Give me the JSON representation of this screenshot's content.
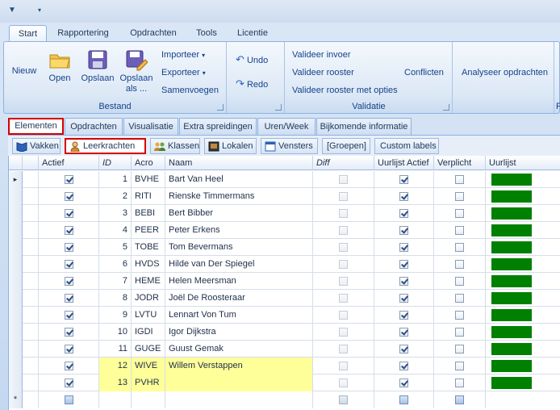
{
  "ribbon_tabs": [
    {
      "label": "Start"
    },
    {
      "label": "Rapportering"
    },
    {
      "label": "Opdrachten"
    },
    {
      "label": "Tools"
    },
    {
      "label": "Licentie"
    }
  ],
  "groups": {
    "bestand": {
      "label": "Bestand",
      "nieuw": "Nieuw",
      "open": "Open",
      "opslaan": "Opslaan",
      "opslaan_als_1": "Opslaan",
      "opslaan_als_2": "als ...",
      "importeer": "Importeer",
      "exporteer": "Exporteer",
      "samenvoegen": "Samenvoegen"
    },
    "edit": {
      "undo": "Undo",
      "redo": "Redo"
    },
    "validatie": {
      "label": "Validatie",
      "invoer": "Valideer invoer",
      "rooster": "Valideer rooster",
      "opties": "Valideer rooster met opties",
      "conflicten": "Conflicten"
    },
    "analyse": {
      "label": "Analyseer opdrachten",
      "cut": "P"
    }
  },
  "element_tabs": [
    {
      "label": "Elementen"
    },
    {
      "label": "Opdrachten"
    },
    {
      "label": "Visualisatie"
    },
    {
      "label": "Extra spreidingen"
    },
    {
      "label": "Uren/Week"
    },
    {
      "label": "Bijkomende informatie"
    }
  ],
  "sub_tabs": [
    {
      "label": "Vakken"
    },
    {
      "label": "Leerkrachten"
    },
    {
      "label": "Klassen"
    },
    {
      "label": "Lokalen"
    },
    {
      "label": "Vensters"
    },
    {
      "label": "[Groepen]"
    },
    {
      "label": "Custom labels"
    }
  ],
  "grid": {
    "columns": {
      "actief": "Actief",
      "id": "ID",
      "acro": "Acro",
      "naam": "Naam",
      "diff": "Diff",
      "uurlijst_actief": "Uurlijst Actief",
      "verplicht": "Verplicht",
      "uurlijst": "Uurlijst"
    },
    "rows": [
      {
        "id": "1",
        "acro": "BVHE",
        "naam": "Bart Van Heel"
      },
      {
        "id": "2",
        "acro": "RITI",
        "naam": "Rienske Timmermans"
      },
      {
        "id": "3",
        "acro": "BEBI",
        "naam": "Bert Bibber"
      },
      {
        "id": "4",
        "acro": "PEER",
        "naam": "Peter Erkens"
      },
      {
        "id": "5",
        "acro": "TOBE",
        "naam": "Tom Bevermans"
      },
      {
        "id": "6",
        "acro": "HVDS",
        "naam": "Hilde van Der Spiegel"
      },
      {
        "id": "7",
        "acro": "HEME",
        "naam": "Helen Meersman"
      },
      {
        "id": "8",
        "acro": "JODR",
        "naam": "Joël De Roosteraar"
      },
      {
        "id": "9",
        "acro": "LVTU",
        "naam": "Lennart Von Tum"
      },
      {
        "id": "10",
        "acro": "IGDI",
        "naam": "Igor Dijkstra"
      },
      {
        "id": "11",
        "acro": "GUGE",
        "naam": "Guust Gemak"
      },
      {
        "id": "12",
        "acro": "WIVE",
        "naam": "Willem Verstappen"
      },
      {
        "id": "13",
        "acro": "PVHR",
        "naam": ""
      }
    ],
    "new_row_marker": "*",
    "current_row_marker": "▸"
  },
  "colors": {
    "bar": "#008000",
    "highlight": "#ffff99",
    "selection_border": "#d40000"
  }
}
